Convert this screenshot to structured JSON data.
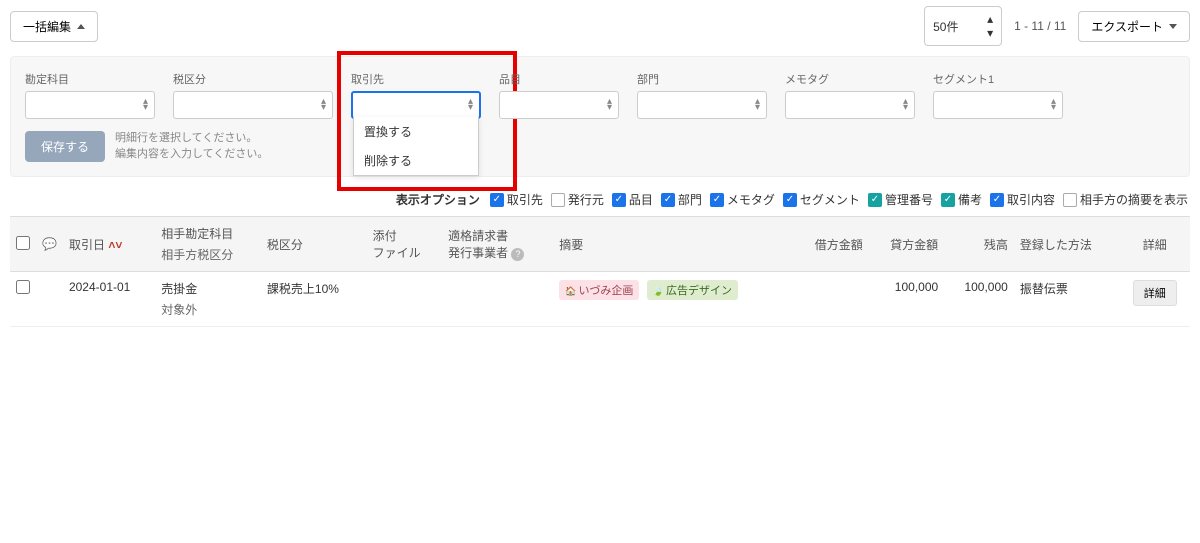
{
  "toolbar": {
    "bulk_edit": "一括編集",
    "page_size": "50件",
    "page_count": "1 - 11 / 11",
    "export": "エクスポート"
  },
  "filters": {
    "labels": {
      "account": "勘定科目",
      "tax": "税区分",
      "partner": "取引先",
      "item": "品目",
      "department": "部門",
      "memotag": "メモタグ",
      "segment1": "セグメント1"
    },
    "dropdown_options": [
      "置換する",
      "削除する"
    ],
    "save_button": "保存する",
    "help_line1": "明細行を選択してください。",
    "help_line2": "編集内容を入力してください。"
  },
  "display_options": {
    "label": "表示オプション",
    "items": [
      {
        "label": "取引先",
        "checked": true,
        "style": "blue"
      },
      {
        "label": "発行元",
        "checked": false,
        "style": "off"
      },
      {
        "label": "品目",
        "checked": true,
        "style": "blue"
      },
      {
        "label": "部門",
        "checked": true,
        "style": "blue"
      },
      {
        "label": "メモタグ",
        "checked": true,
        "style": "blue"
      },
      {
        "label": "セグメント",
        "checked": true,
        "style": "blue"
      },
      {
        "label": "管理番号",
        "checked": true,
        "style": "teal"
      },
      {
        "label": "備考",
        "checked": true,
        "style": "teal"
      },
      {
        "label": "取引内容",
        "checked": true,
        "style": "blue"
      },
      {
        "label": "相手方の摘要を表示",
        "checked": false,
        "style": "off"
      }
    ]
  },
  "table": {
    "headers": {
      "date": "取引日",
      "counter_account": "相手勘定科目",
      "counter_tax": "相手方税区分",
      "tax": "税区分",
      "attachment": "添付\nファイル",
      "invoice_issuer": "適格請求書\n発行事業者",
      "summary": "摘要",
      "debit": "借方金額",
      "credit": "貸方金額",
      "balance": "残高",
      "method": "登録した方法",
      "detail": "詳細"
    },
    "rows": [
      {
        "date": "2024-01-01",
        "counter_account": "売掛金",
        "counter_tax": "対象外",
        "tax": "課税売上10%",
        "tag1": "いづみ企画",
        "tag2": "広告デザイン",
        "credit": "100,000",
        "balance": "100,000",
        "method": "振替伝票",
        "detail_label": "詳細"
      }
    ]
  }
}
